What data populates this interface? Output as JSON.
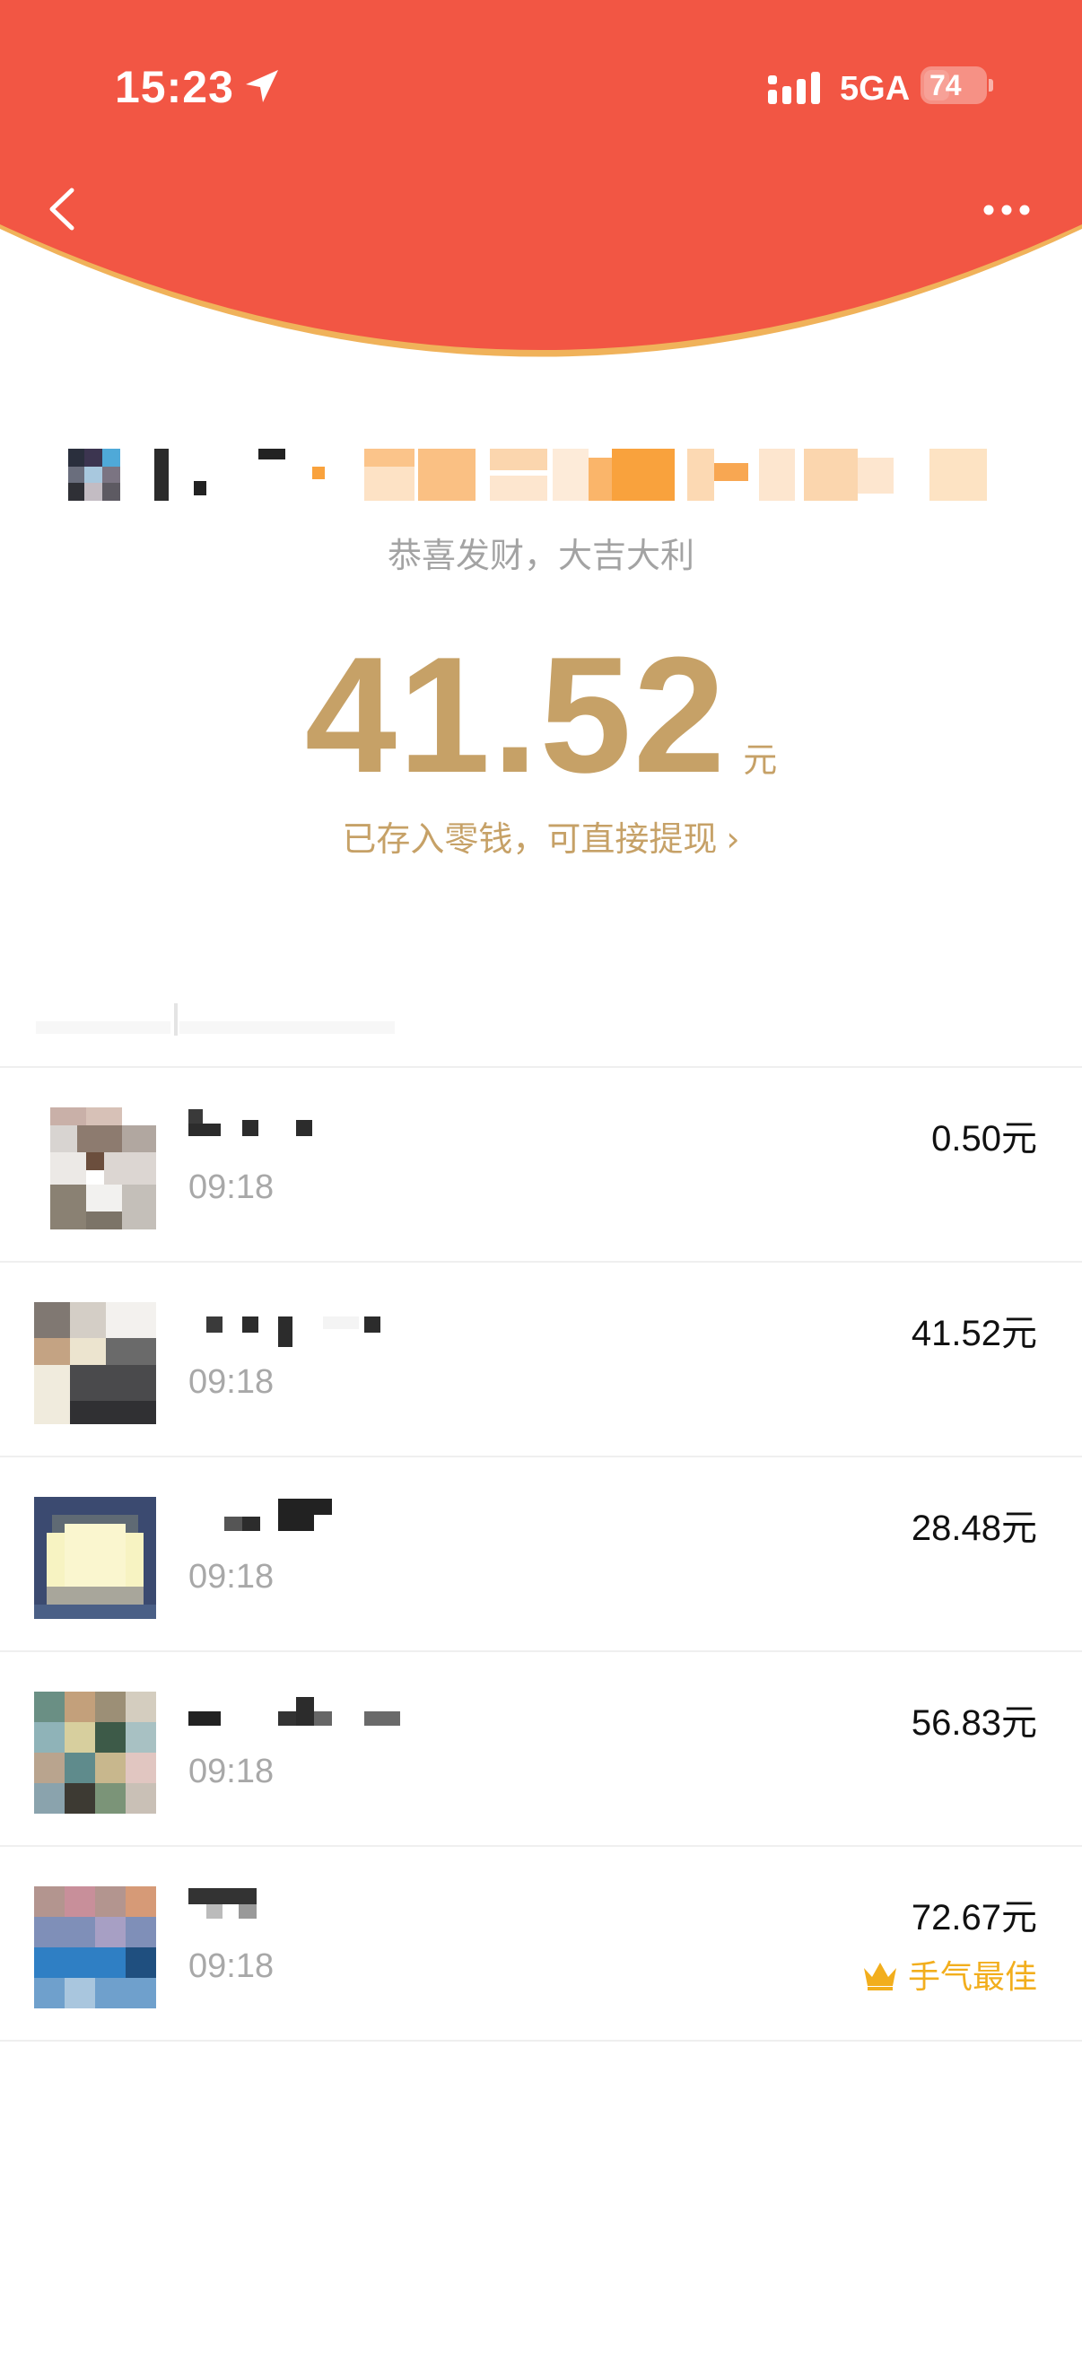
{
  "status_bar": {
    "time": "15:23",
    "network": "5GA",
    "battery": "74",
    "location_icon": "location-arrow-icon",
    "signal_icon": "signal-bars-icon"
  },
  "nav": {
    "back_icon": "chevron-left-icon",
    "more_icon": "more-dots-icon"
  },
  "colors": {
    "header_red": "#f25644",
    "gold": "#c6a167",
    "crown_yellow": "#f2ae1d"
  },
  "packet": {
    "greeting": "恭喜发财，大吉大利",
    "amount": "41.52",
    "unit": "元",
    "wallet_link": "已存入零钱，可直接提现",
    "wallet_chevron": "›"
  },
  "recipients": [
    {
      "time": "09:18",
      "amount": "0.50元",
      "best": false
    },
    {
      "time": "09:18",
      "amount": "41.52元",
      "best": false
    },
    {
      "time": "09:18",
      "amount": "28.48元",
      "best": false
    },
    {
      "time": "09:18",
      "amount": "56.83元",
      "best": false
    },
    {
      "time": "09:18",
      "amount": "72.67元",
      "best": true,
      "best_label": "手气最佳"
    }
  ]
}
